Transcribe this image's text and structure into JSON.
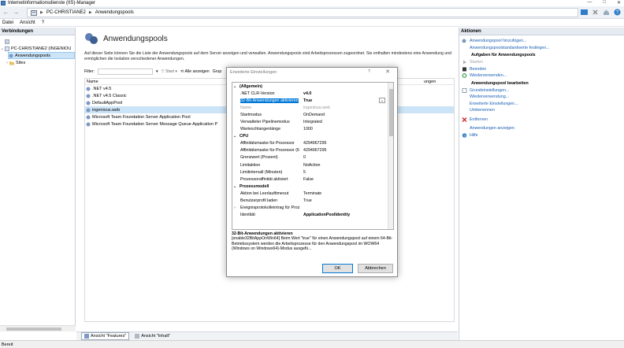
{
  "window": {
    "title": "Internetinformationsdienste (IIS)-Manager",
    "controls": [
      "—",
      "□",
      "✕"
    ]
  },
  "addressbar": {
    "crumbs": [
      "PC-CHRISTIANE2",
      "Anwendungspools"
    ]
  },
  "menu": [
    "Datei",
    "Ansicht",
    "?"
  ],
  "left": {
    "header": "Verbindungen",
    "tree": [
      {
        "label": "",
        "level": 0
      },
      {
        "label": "PC-CHRISTIANE2 (INGENIOU",
        "level": 1
      },
      {
        "label": "Anwendungspools",
        "level": 2,
        "selected": true
      },
      {
        "label": "Sites",
        "level": 2
      }
    ]
  },
  "content": {
    "title": "Anwendungspools",
    "description": "Auf dieser Seite können Sie die Liste der Anwendungspools auf dem Server anzeigen und verwalten. Anwendungspools sind Arbeitsprozessen zugeordnet. Sie enthalten mindestens eine Anwendung und ermöglichen die Isolation verschiedener Anwendungen.",
    "filter_label": "Filter:",
    "start_label": "Start",
    "show_all_label": "Alle anzeigen",
    "group_label": "Grup",
    "columns": [
      "Name",
      "ungen"
    ],
    "rows": [
      {
        "name": ".NET v4.5",
        "selected": false
      },
      {
        "name": ".NET v4.5 Classic",
        "selected": false
      },
      {
        "name": "DefaultAppPool",
        "selected": false
      },
      {
        "name": "ingenious.web",
        "selected": true
      },
      {
        "name": "Microsoft Team Foundation Server Application Pool",
        "selected": false
      },
      {
        "name": "Microsoft Team Foundation Server Message Queue Application P",
        "selected": false
      }
    ]
  },
  "tabs": {
    "features": "Ansicht \"Features\"",
    "content": "Ansicht \"Inhalt\""
  },
  "right": {
    "header": "Aktionen",
    "actions": [
      {
        "label": "Anwendungspool hinzufügen...",
        "type": "link",
        "icon": "add-pool-icon"
      },
      {
        "label": "Anwendungspoolstandardwerte festlegen...",
        "type": "link",
        "icon": ""
      },
      {
        "label": "Aufgaben für Anwendungspools",
        "type": "group"
      },
      {
        "label": "Starten",
        "type": "disabled",
        "icon": "play-icon"
      },
      {
        "label": "Beenden",
        "type": "link",
        "icon": "stop-icon"
      },
      {
        "label": "Wiederverwenden...",
        "type": "link",
        "icon": "recycle-icon"
      },
      {
        "label": "Anwendungspool bearbeiten",
        "type": "group"
      },
      {
        "label": "Grundeinstellungen...",
        "type": "link",
        "icon": "settings-icon"
      },
      {
        "label": "Wiederverwendung...",
        "type": "link",
        "icon": ""
      },
      {
        "label": "Erweiterte Einstellungen...",
        "type": "link",
        "icon": ""
      },
      {
        "label": "Umbenennen",
        "type": "link",
        "icon": ""
      },
      {
        "label": "Entfernen",
        "type": "link",
        "icon": "delete-icon"
      },
      {
        "label": "Anwendungen anzeigen",
        "type": "link",
        "icon": ""
      },
      {
        "label": "Hilfe",
        "type": "link",
        "icon": "help-icon"
      }
    ]
  },
  "status": "Bereit",
  "dialog": {
    "title": "Erweiterte Einstellungen",
    "help": "?",
    "close": "✕",
    "rows": [
      {
        "kind": "cat",
        "label": "(Allgemein)"
      },
      {
        "kind": "prop",
        "name": ".NET CLR-Version",
        "value": "v4.0",
        "bold": true
      },
      {
        "kind": "prop",
        "name": "32-Bit-Anwendungen aktivieren",
        "value": "True",
        "bold": true,
        "selected": true
      },
      {
        "kind": "prop",
        "name": "Name",
        "value": "ingenious.web",
        "gray": true
      },
      {
        "kind": "prop",
        "name": "Startmodus",
        "value": "OnDemand"
      },
      {
        "kind": "prop",
        "name": "Verwalteter Pipelinemodus",
        "value": "Integrated"
      },
      {
        "kind": "prop",
        "name": "Warteschlangenlänge",
        "value": "1000"
      },
      {
        "kind": "cat",
        "label": "CPU"
      },
      {
        "kind": "prop",
        "name": "Affinitätsmaske für Prozessor",
        "value": "4294967295"
      },
      {
        "kind": "prop",
        "name": "Affinitätsmaske für Prozessor (6",
        "value": "4294967295"
      },
      {
        "kind": "prop",
        "name": "Grenzwert (Prozent)",
        "value": "0"
      },
      {
        "kind": "prop",
        "name": "Limitaktion",
        "value": "NoAction"
      },
      {
        "kind": "prop",
        "name": "Limitintervall (Minuten)",
        "value": "5"
      },
      {
        "kind": "prop",
        "name": "Prozessoraffinität aktiviert",
        "value": "False"
      },
      {
        "kind": "cat",
        "label": "Prozessmodell"
      },
      {
        "kind": "prop",
        "name": "Aktion bei Leerlauftimeout",
        "value": "Terminate"
      },
      {
        "kind": "prop",
        "name": "Benutzerprofil laden",
        "value": "True"
      },
      {
        "kind": "prop",
        "name": "Ereignisprotokolleintrag für Proz",
        "value": "",
        "expand": true
      },
      {
        "kind": "prop",
        "name": "Identität",
        "value": "ApplicationPoolIdentity",
        "bold": true
      }
    ],
    "desc_title": "32-Bit-Anwendungen aktivieren",
    "desc_text": "[enable32BitAppOnWin64] Beim Wert \"true\" für einen Anwendungspool auf einem 64-Bit-Betriebssystem werden die Arbeitsprozesse für den Anwendungspool im WOW64 (Windows on Windows64)-Modus ausgefü...",
    "ok": "OK",
    "cancel": "Abbrechen"
  },
  "colors": {
    "accent": "#0078d7",
    "link": "#1a5fb4",
    "selection": "#cce4f7"
  }
}
